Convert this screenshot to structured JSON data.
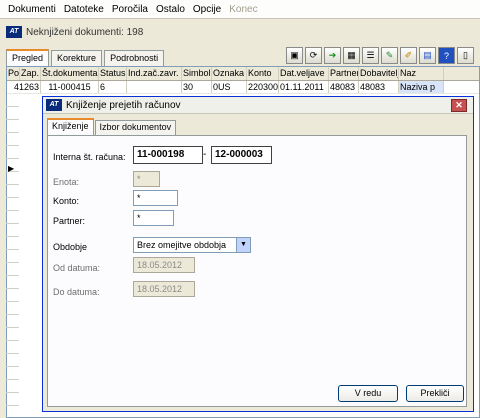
{
  "menu": [
    "Dokumenti",
    "Datoteke",
    "Poročila",
    "Ostalo",
    "Opcije",
    "Konec"
  ],
  "window_title": "Neknjiženi dokumenti: 198",
  "tabs": [
    "Pregled",
    "Korekture",
    "Podrobnosti"
  ],
  "toolbar_icons": [
    "folder-icon",
    "refresh-icon",
    "arrow-right-icon",
    "table-icon",
    "list-icon",
    "edit-icon",
    "pencil-icon",
    "comment-icon",
    "help-icon",
    "document-icon"
  ],
  "grid": {
    "columns": [
      "Pod",
      "Zap. št.",
      "Št.dokumenta",
      "Status",
      "Ind.zač.zavr.",
      "Simbol",
      "Oznaka",
      "Konto",
      "Dat.veljave",
      "Partner",
      "Dobavitelj",
      "Naz"
    ],
    "rows": [
      [
        "",
        "41263",
        "11-000415",
        "6",
        "",
        "30",
        "0US",
        "220300",
        "01.11.2011",
        "48083",
        "48083",
        "Naziva p"
      ]
    ]
  },
  "dialog": {
    "title": "Knjiženje prejetih računov",
    "tabs": [
      "Knjiženje",
      "Izbor dokumentov"
    ],
    "interna_label": "Interna št. računa:",
    "interna_from": "11-000198",
    "interna_dash": "-",
    "interna_to": "12-000003",
    "enota_label": "Enota:",
    "enota_value": "*",
    "konto_label": "Konto:",
    "konto_value": "*",
    "partner_label": "Partner:",
    "partner_value": "*",
    "obdobje_label": "Obdobje",
    "obdobje_value": "Brez omejitve obdobja",
    "od_label": "Od datuma:",
    "od_value": "18.05.2012",
    "do_label": "Do datuma:",
    "do_value": "18.05.2012",
    "ok_label": "V redu",
    "cancel_label": "Prekliči"
  }
}
